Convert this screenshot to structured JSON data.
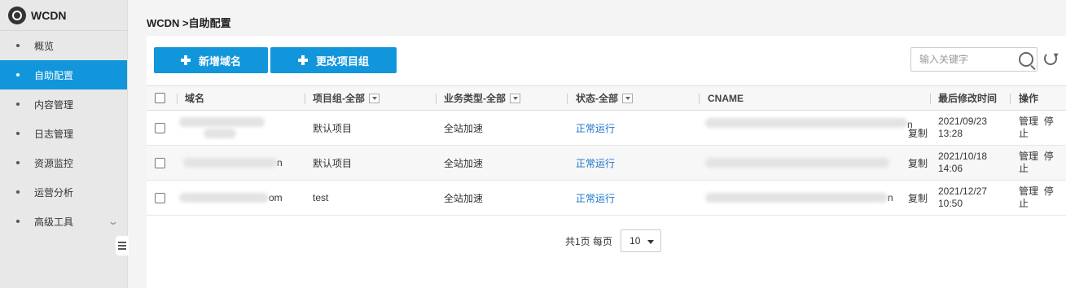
{
  "app": {
    "title": "WCDN"
  },
  "sidebar": {
    "items": [
      {
        "label": "概览",
        "active": false
      },
      {
        "label": "自助配置",
        "active": true
      },
      {
        "label": "内容管理",
        "active": false
      },
      {
        "label": "日志管理",
        "active": false
      },
      {
        "label": "资源监控",
        "active": false
      },
      {
        "label": "运营分析",
        "active": false
      },
      {
        "label": "高级工具",
        "active": false,
        "expandable": true
      }
    ]
  },
  "breadcrumb": "WCDN >自助配置",
  "toolbar": {
    "add_domain_label": "新增域名",
    "change_group_label": "更改项目组",
    "search_placeholder": "输入关键字"
  },
  "table": {
    "headers": {
      "domain": "域名",
      "group": "项目组-全部",
      "service": "业务类型-全部",
      "status": "状态-全部",
      "cname": "CNAME",
      "modified": "最后修改时间",
      "ops": "操作"
    },
    "rows": [
      {
        "domain_suffix": "",
        "group": "默认项目",
        "service": "全站加速",
        "status": "正常运行",
        "cname_suffix": "n",
        "copy": "复制",
        "date": "2021/09/23",
        "time": "13:28",
        "manage": "管理",
        "stop": "停止"
      },
      {
        "domain_suffix": "n",
        "group": "默认项目",
        "service": "全站加速",
        "status": "正常运行",
        "cname_suffix": "",
        "copy": "复制",
        "date": "2021/10/18",
        "time": "14:06",
        "manage": "管理",
        "stop": "停止"
      },
      {
        "domain_suffix": "om",
        "group": "test",
        "service": "全站加速",
        "status": "正常运行",
        "cname_suffix": "n",
        "copy": "复制",
        "date": "2021/12/27",
        "time": "10:50",
        "manage": "管理",
        "stop": "停止"
      }
    ]
  },
  "pagination": {
    "summary": "共1页 每页",
    "page_size": "10"
  },
  "colors": {
    "accent": "#1296db",
    "link": "#1a73c9"
  }
}
